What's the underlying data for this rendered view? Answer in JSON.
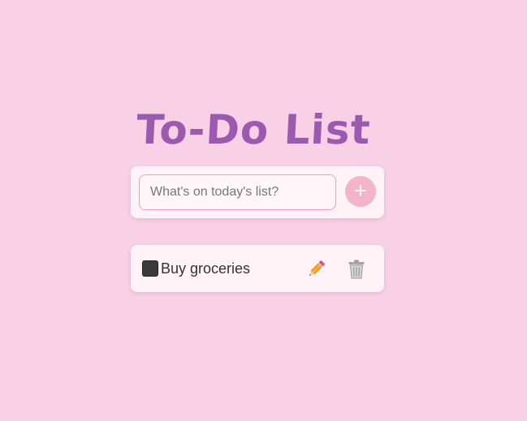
{
  "app": {
    "title": "To-Do List"
  },
  "input": {
    "placeholder": "What's on today's list?",
    "value": "",
    "add_button_label": "+"
  },
  "tasks": [
    {
      "text": "Buy groceries",
      "completed": false,
      "edit_icon": "pencil-icon",
      "delete_icon": "trash-icon"
    }
  ],
  "colors": {
    "background": "#f8d1e6",
    "title": "#9b59b0",
    "card": "#fff3f8",
    "input_border": "#f29ab8",
    "add_button": "#f2b4c6"
  }
}
